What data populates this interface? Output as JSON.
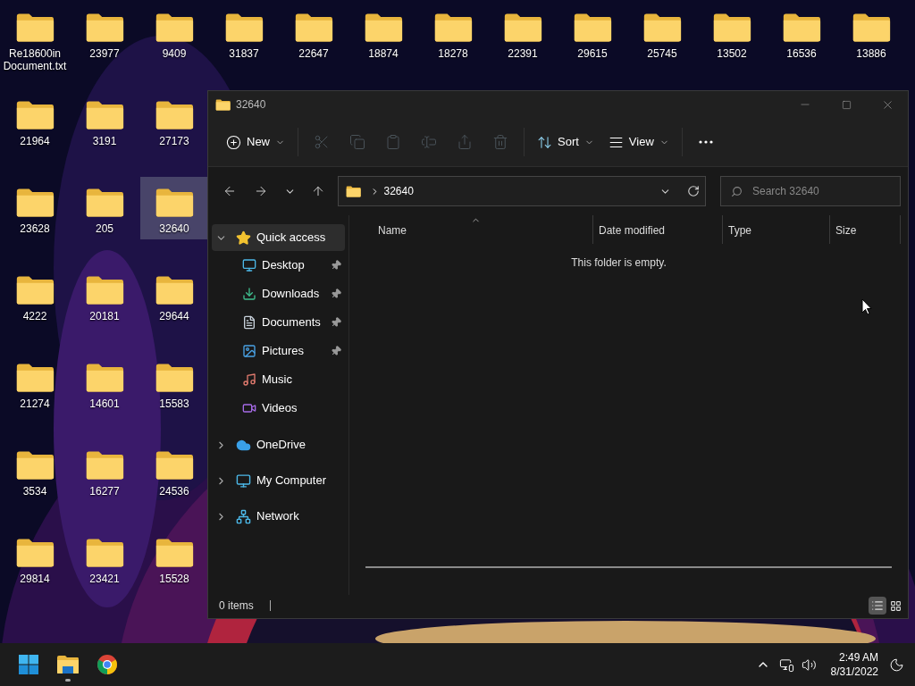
{
  "desktop": {
    "rows": [
      [
        {
          "label": "Re18600in Document.txt",
          "selected": false
        },
        {
          "label": "23977",
          "selected": false
        },
        {
          "label": "9409",
          "selected": false
        },
        {
          "label": "31837",
          "selected": false
        },
        {
          "label": "22647",
          "selected": false
        },
        {
          "label": "18874",
          "selected": false
        },
        {
          "label": "18278",
          "selected": false
        },
        {
          "label": "22391",
          "selected": false
        },
        {
          "label": "29615",
          "selected": false
        },
        {
          "label": "25745",
          "selected": false
        },
        {
          "label": "13502",
          "selected": false
        },
        {
          "label": "16536",
          "selected": false
        },
        {
          "label": "13886",
          "selected": false
        }
      ],
      [
        {
          "label": "21964",
          "selected": false
        },
        {
          "label": "3191",
          "selected": false
        },
        {
          "label": "27173",
          "selected": false
        }
      ],
      [
        {
          "label": "23628",
          "selected": false
        },
        {
          "label": "205",
          "selected": false
        },
        {
          "label": "32640",
          "selected": true
        }
      ],
      [
        {
          "label": "4222",
          "selected": false
        },
        {
          "label": "20181",
          "selected": false
        },
        {
          "label": "29644",
          "selected": false
        }
      ],
      [
        {
          "label": "21274",
          "selected": false
        },
        {
          "label": "14601",
          "selected": false
        },
        {
          "label": "15583",
          "selected": false
        }
      ],
      [
        {
          "label": "3534",
          "selected": false
        },
        {
          "label": "16277",
          "selected": false
        },
        {
          "label": "24536",
          "selected": false
        }
      ],
      [
        {
          "label": "29814",
          "selected": false
        },
        {
          "label": "23421",
          "selected": false
        },
        {
          "label": "15528",
          "selected": false
        }
      ]
    ]
  },
  "window": {
    "title": "32640",
    "toolbar": [
      {
        "kind": "menu",
        "label": "New",
        "disabled": false
      },
      {
        "kind": "icon",
        "disabled": true
      },
      {
        "kind": "icon",
        "disabled": true
      },
      {
        "kind": "icon",
        "disabled": true
      },
      {
        "kind": "icon",
        "disabled": true
      },
      {
        "kind": "icon",
        "disabled": true
      },
      {
        "kind": "icon",
        "disabled": true
      },
      {
        "kind": "menu",
        "label": "Sort",
        "disabled": false
      },
      {
        "kind": "menu",
        "label": "View",
        "disabled": false
      },
      {
        "kind": "more",
        "disabled": false
      }
    ],
    "address": {
      "path": [
        "32640"
      ]
    },
    "search": {
      "placeholder": "Search 32640"
    },
    "sidebar": {
      "items": [
        {
          "label": "Quick access",
          "expanded": true,
          "selected": true,
          "children": [
            {
              "label": "Desktop",
              "pinned": true,
              "selected": false
            },
            {
              "label": "Downloads",
              "pinned": true,
              "selected": false
            },
            {
              "label": "Documents",
              "pinned": true,
              "selected": false
            },
            {
              "label": "Pictures",
              "pinned": true,
              "selected": false
            },
            {
              "label": "Music",
              "pinned": false,
              "selected": false
            },
            {
              "label": "Videos",
              "pinned": false,
              "selected": false
            }
          ]
        },
        {
          "label": "OneDrive",
          "expanded": false,
          "selected": false
        },
        {
          "label": "My Computer",
          "expanded": false,
          "selected": false
        },
        {
          "label": "Network",
          "expanded": false,
          "selected": false
        }
      ]
    },
    "columns": [
      {
        "label": "Name",
        "sorted": true
      },
      {
        "label": "Date modified",
        "sorted": false
      },
      {
        "label": "Type",
        "sorted": false
      },
      {
        "label": "Size",
        "sorted": false
      }
    ],
    "empty_message": "This folder is empty.",
    "status_bar": {
      "items": "0 items",
      "views": [
        {
          "kind": "details",
          "selected": true
        },
        {
          "kind": "tiles",
          "selected": false
        }
      ]
    }
  },
  "taskbar": {
    "apps": [
      {
        "kind": "start",
        "running": false
      },
      {
        "kind": "explorer",
        "running": true
      },
      {
        "kind": "chrome",
        "running": false
      }
    ],
    "clock": {
      "time": "2:49 AM",
      "date": "8/31/2022"
    }
  }
}
